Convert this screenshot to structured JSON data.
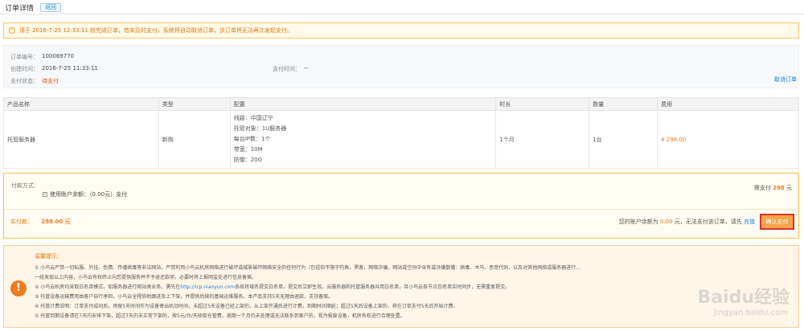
{
  "header": {
    "title": "订单详情",
    "back_label": "返回"
  },
  "notice": {
    "prefix": "请于",
    "deadline": "2016-7-25 12:33:11",
    "suffix": "前完成订单，若未及时支付，系统将自动取消订单，该订单将无法再次发起支付。"
  },
  "order": {
    "number_label": "订单编号：",
    "number_value": "100069770",
    "created_label": "创建时间：",
    "created_value": "2016-7-25 11:33:11",
    "pay_time_label": "支付时间：",
    "pay_time_value": "--",
    "status_label": "支付状态：",
    "status_value": "待支付",
    "cancel_label": "取消订单"
  },
  "table": {
    "headers": [
      "产品名称",
      "类型",
      "配置",
      "时长",
      "数量",
      "费用"
    ],
    "row": {
      "name": "托管服务器",
      "type": "新购",
      "config": [
        "线路：中国辽宁",
        "托管对象：1U服务器",
        "每台IP数：1个",
        "带宽：10M",
        "防御：20G"
      ],
      "duration": "1个月",
      "quantity": "1台",
      "price": "¥ 298.00"
    }
  },
  "payment": {
    "method_label": "付款方式：",
    "method_option": "使用账户余额：（0.00元）支付",
    "need_pay_prefix": "需支付",
    "need_pay_amount": "298",
    "need_pay_unit": "元",
    "actual_label": "实付款：",
    "actual_amount": "298.00 元",
    "balance_prefix": "您的账户余额为",
    "balance_amount": "0.00",
    "balance_suffix": "元，无法支付该订单，请先",
    "recharge_label": "充值",
    "confirm_label": "确认支付"
  },
  "tips": {
    "title": "温馨提示：",
    "items": [
      {
        "text": "① 小鸟云严禁一切私服、外挂、色情、传播病毒等非法网站，严禁利用小鸟云机房网络进行破坏或威胁破坏网络安全的任何行为（包括但不限于钓鱼，黑客，网络诈骗，网站或空间中含有或涉嫌散播：病毒、木马、恶意代码，以及对其他网络或服务器进行..."
      },
      {
        "text": "一经发现以上内容，小鸟云有权终止向您提供服务并不予退还款项，必要时将上报网监处进行信息备案。"
      },
      {
        "text": "② 小鸟云机房均采取白名单模式，如服务器进行网站类业务，需先在",
        "link": "http://icp.niaoyun.com",
        "tail": "系统将域名提交白名单，提交后立即生效。云服务器和托管服务器共用白名单，且小鸟云各节点白名单实时同步，无需重复提交。"
      },
      {
        "text": "③ 托管设备运输费用由客户自行承担，小鸟云全程协助跟进及上下架，并提供后续的基础运维服务。本产品支持5天无理由退款，支持备案。"
      },
      {
        "text": "④ 托管计费说明：订单支付成功后，预留5天时间作为设备寄出机动时间，未超过5天设备已经上架的，从上架开通后进行计费，到期时间顺延；超过5天后设备上架的，将在订单支付5天后开始计费。"
      },
      {
        "text": "⑤ 托管到期设备请在7天内安排下架，超过7天仍未正常下架的，按5元/台/天收取仓管费，逾期一个月仍未处理或无法联系到客户的，视为报废设备，机房有权进行合理处置。"
      }
    ]
  },
  "watermark": {
    "brand": "Baidu经验",
    "domain": "jingyan.baidu.com"
  }
}
